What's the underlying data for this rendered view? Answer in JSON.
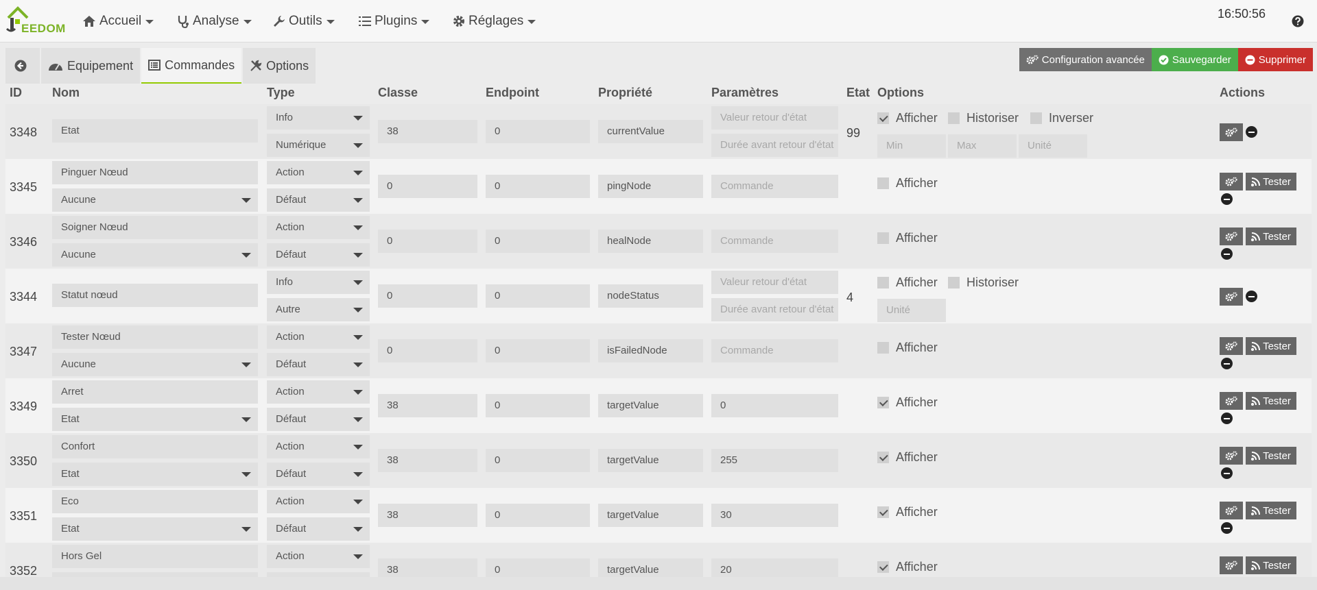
{
  "brand": {
    "logo_text": "EEDOM",
    "accent": "#94ca02"
  },
  "nav": {
    "items": [
      {
        "label": "Accueil",
        "icon": "home-icon"
      },
      {
        "label": "Analyse",
        "icon": "stethoscope-icon"
      },
      {
        "label": "Outils",
        "icon": "wrench-icon"
      },
      {
        "label": "Plugins",
        "icon": "tasks-icon"
      },
      {
        "label": "Réglages",
        "icon": "cog-icon"
      }
    ],
    "clock": "16:50:56"
  },
  "tabs": {
    "equipement": "Equipement",
    "commandes": "Commandes",
    "options": "Options"
  },
  "actions": {
    "config": "Configuration avancée",
    "save": "Sauvegarder",
    "delete": "Supprimer",
    "test": "Tester"
  },
  "columns": {
    "id": "ID",
    "nom": "Nom",
    "type": "Type",
    "classe": "Classe",
    "endpoint": "Endpoint",
    "propriete": "Propriété",
    "parametres": "Paramètres",
    "etat": "Etat",
    "options": "Options",
    "actions": "Actions"
  },
  "placeholders": {
    "valeur_retour": "Valeur retour d'état",
    "duree_retour": "Durée avant retour d'état",
    "commande": "Commande",
    "min": "Min",
    "max": "Max",
    "unite": "Unité"
  },
  "options_labels": {
    "afficher": "Afficher",
    "historiser": "Historiser",
    "inverser": "Inverser"
  },
  "rows": [
    {
      "id": "3348",
      "nom": "Etat",
      "value_sel": "",
      "type": "Info",
      "subtype": "Numérique",
      "classe": "38",
      "endpoint": "0",
      "propriete": "currentValue",
      "param": "",
      "etat": "99",
      "afficher": true
    },
    {
      "id": "3345",
      "nom": "Pinguer Nœud",
      "value_sel": "Aucune",
      "type": "Action",
      "subtype": "Défaut",
      "classe": "0",
      "endpoint": "0",
      "propriete": "pingNode",
      "param": "",
      "etat": "",
      "afficher": false
    },
    {
      "id": "3346",
      "nom": "Soigner Nœud",
      "value_sel": "Aucune",
      "type": "Action",
      "subtype": "Défaut",
      "classe": "0",
      "endpoint": "0",
      "propriete": "healNode",
      "param": "",
      "etat": "",
      "afficher": false
    },
    {
      "id": "3344",
      "nom": "Statut nœud",
      "value_sel": "",
      "type": "Info",
      "subtype": "Autre",
      "classe": "0",
      "endpoint": "0",
      "propriete": "nodeStatus",
      "param": "",
      "etat": "4",
      "afficher": false
    },
    {
      "id": "3347",
      "nom": "Tester Nœud",
      "value_sel": "Aucune",
      "type": "Action",
      "subtype": "Défaut",
      "classe": "0",
      "endpoint": "0",
      "propriete": "isFailedNode",
      "param": "",
      "etat": "",
      "afficher": false
    },
    {
      "id": "3349",
      "nom": "Arret",
      "value_sel": "Etat",
      "type": "Action",
      "subtype": "Défaut",
      "classe": "38",
      "endpoint": "0",
      "propriete": "targetValue",
      "param": "0",
      "etat": "",
      "afficher": true
    },
    {
      "id": "3350",
      "nom": "Confort",
      "value_sel": "Etat",
      "type": "Action",
      "subtype": "Défaut",
      "classe": "38",
      "endpoint": "0",
      "propriete": "targetValue",
      "param": "255",
      "etat": "",
      "afficher": true
    },
    {
      "id": "3351",
      "nom": "Eco",
      "value_sel": "Etat",
      "type": "Action",
      "subtype": "Défaut",
      "classe": "38",
      "endpoint": "0",
      "propriete": "targetValue",
      "param": "30",
      "etat": "",
      "afficher": true
    },
    {
      "id": "3352",
      "nom": "Hors Gel",
      "value_sel": "",
      "type": "Action",
      "subtype": "",
      "classe": "38",
      "endpoint": "0",
      "propriete": "targetValue",
      "param": "20",
      "etat": "",
      "afficher": true
    }
  ]
}
